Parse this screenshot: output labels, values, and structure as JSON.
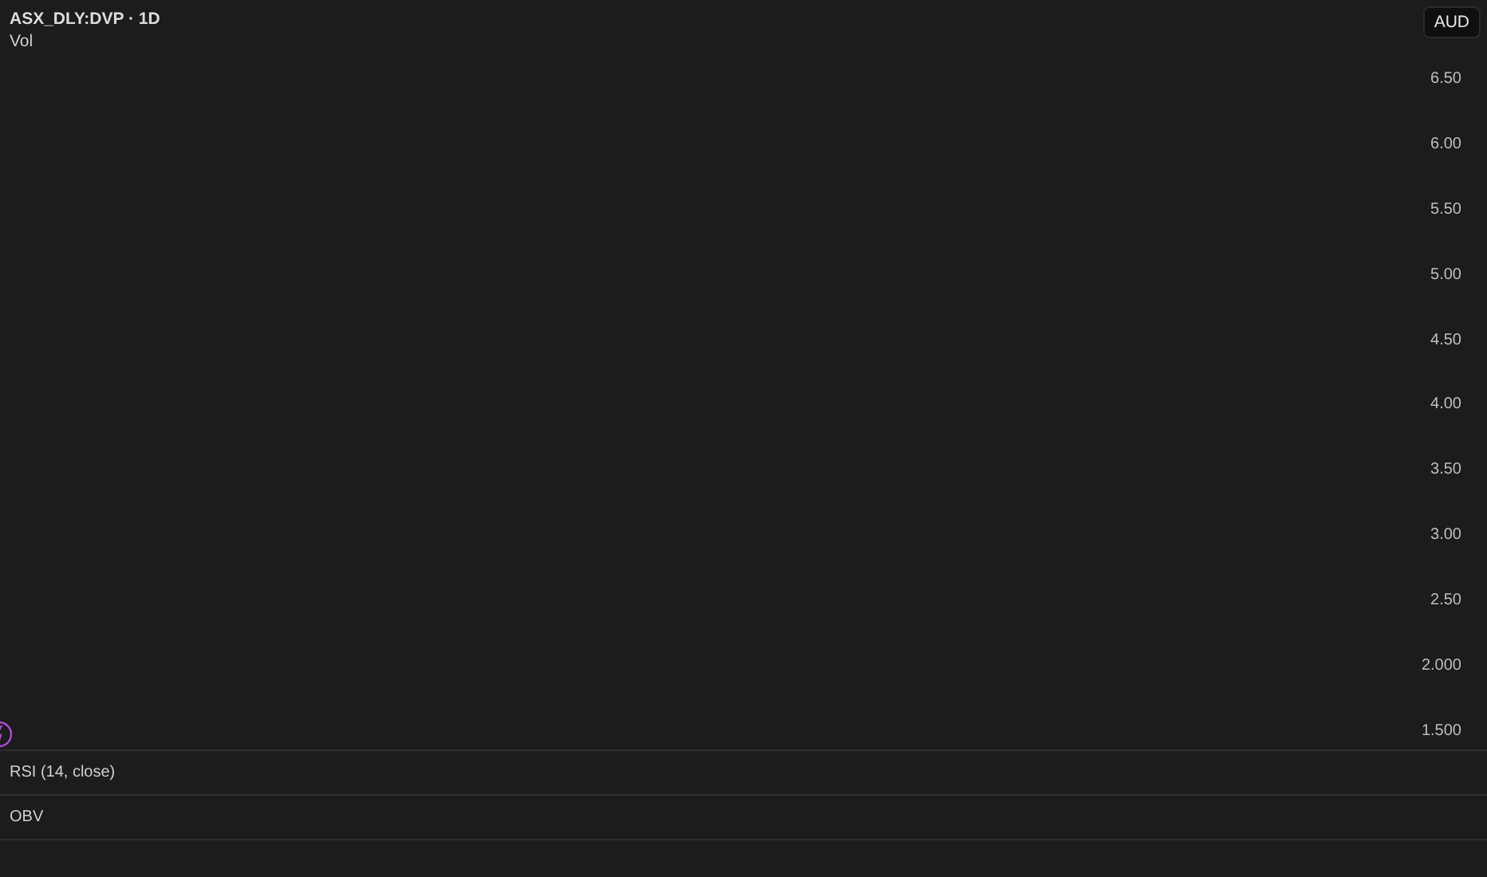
{
  "chart_header": {
    "symbol": "ASX_DLY:DVP · 1D",
    "indicator": "Vol"
  },
  "currency_button": "AUD",
  "price_axis": [
    "6.50",
    "6.00",
    "5.50",
    "5.00",
    "4.50",
    "4.00",
    "3.50",
    "3.00",
    "2.50",
    "2.000",
    "1.500"
  ],
  "panes": [
    {
      "title": "RSI (14, close)"
    },
    {
      "title": "OBV"
    }
  ]
}
